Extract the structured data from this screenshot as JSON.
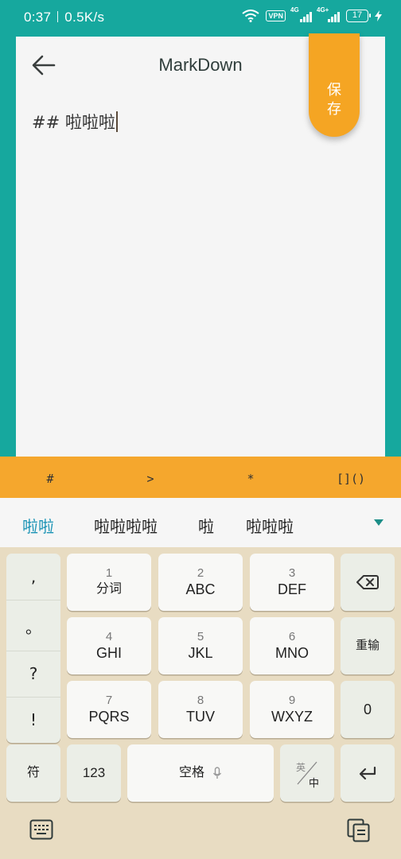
{
  "status": {
    "time": "0:37",
    "speed": "0.5K/s",
    "vpn": "VPN",
    "net1": "4G",
    "net2": "4G+",
    "battery": "17"
  },
  "app": {
    "title": "MarkDown",
    "save_label_line1": "保",
    "save_label_line2": "存",
    "editor_text": "## 啦啦啦"
  },
  "md_toolbar": {
    "items": [
      "#",
      ">",
      "*",
      "[]()"
    ]
  },
  "candidates": {
    "items": [
      "啦啦",
      "啦啦啦啦",
      "啦",
      "啦啦啦"
    ]
  },
  "keyboard": {
    "punct": [
      ",",
      "。",
      "?",
      "!"
    ],
    "keys": [
      {
        "num": "1",
        "label": "分词"
      },
      {
        "num": "2",
        "label": "ABC"
      },
      {
        "num": "3",
        "label": "DEF"
      },
      {
        "num": "4",
        "label": "GHI"
      },
      {
        "num": "5",
        "label": "JKL"
      },
      {
        "num": "6",
        "label": "MNO"
      },
      {
        "num": "7",
        "label": "PQRS"
      },
      {
        "num": "8",
        "label": "TUV"
      },
      {
        "num": "9",
        "label": "WXYZ"
      }
    ],
    "retype_label": "重输",
    "zero_label": "0",
    "symbol_label": "符",
    "num_label": "123",
    "space_label": "空格",
    "lang_top": "英",
    "lang_bottom": "中"
  },
  "colors": {
    "status_bg": "#16a89e",
    "accent_orange": "#f5a523",
    "candidate_active": "#1a93b5",
    "keyboard_bg": "#e8dcc2"
  }
}
